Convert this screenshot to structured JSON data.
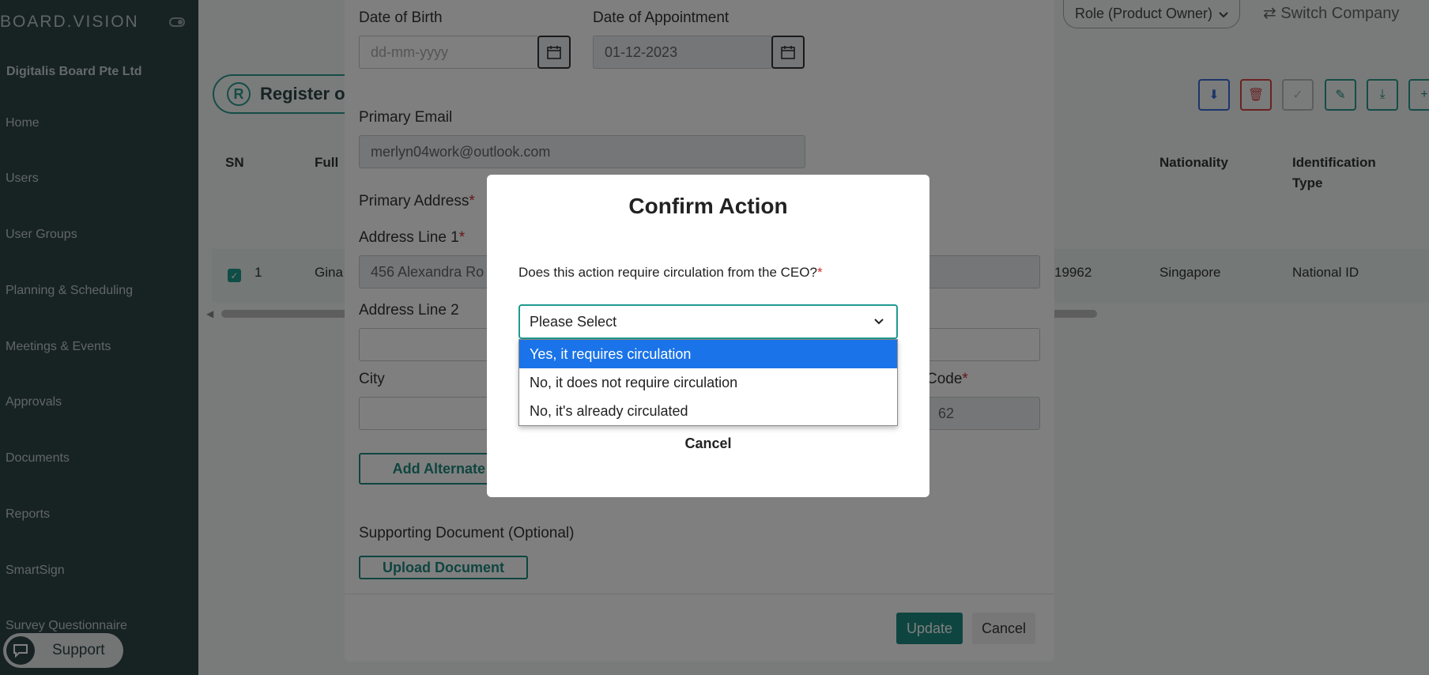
{
  "sidebar": {
    "logo": "BOARD.VISION",
    "company": "Digitalis Board Pte Ltd",
    "items": [
      "Home",
      "Users",
      "User Groups",
      "Planning & Scheduling",
      "Meetings & Events",
      "Approvals",
      "Documents",
      "Reports",
      "SmartSign",
      "Survey Questionnaire"
    ],
    "support_label": "Support"
  },
  "header": {
    "role": "Role (Product Owner)",
    "switch_company": "Switch Company",
    "register_title": "Register o"
  },
  "table": {
    "headers": [
      "SN",
      "Full",
      "Nationality",
      "Identification Type"
    ],
    "row": {
      "sn": "1",
      "name": "Gina",
      "id_fragment": "19962",
      "nationality": "Singapore",
      "id_type": "National ID"
    }
  },
  "edit_form": {
    "dob_label": "Date of Birth",
    "dob_placeholder": "dd-mm-yyyy",
    "doa_label": "Date of Appointment",
    "doa_value": "01-12-2023",
    "email_label": "Primary Email",
    "email_value": "merlyn04work@outlook.com",
    "address_label": "Primary Address",
    "address1_label": "Address Line 1",
    "address1_value": "456 Alexandra Ro",
    "address2_label": "Address Line 2",
    "city_label": "City",
    "postal_label": "Code",
    "postal_value": "62",
    "add_alternate": "Add Alternate A",
    "supporting_label": "Supporting Document (Optional)",
    "upload_label": "Upload Document",
    "update_label": "Update",
    "cancel_label": "Cancel"
  },
  "confirm": {
    "title": "Confirm Action",
    "question": "Does this action require circulation from the CEO?",
    "select_value": "Please Select",
    "options": [
      "Yes, it requires circulation",
      "No, it does not require circulation",
      "No, it's already circulated"
    ],
    "cancel_label": "Cancel"
  },
  "colors": {
    "accent": "#1f8a80",
    "sidebar": "#2f4446",
    "highlight": "#1a73e8",
    "required": "#d12b2b"
  }
}
